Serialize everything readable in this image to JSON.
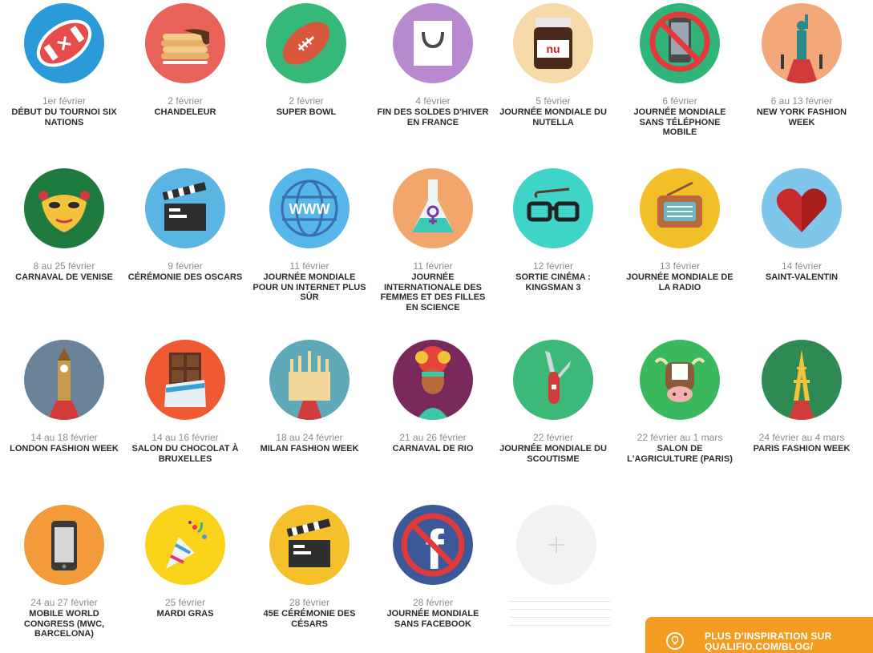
{
  "events": [
    {
      "date": "1er février",
      "title": "DÉBUT DU TOURNOI SIX NATIONS",
      "icon": "rugby-ball-icon",
      "bg": "#2a9ad8"
    },
    {
      "date": "2 février",
      "title": "CHANDELEUR",
      "icon": "crepes-icon",
      "bg": "#e8625a"
    },
    {
      "date": "2 février",
      "title": "SUPER BOWL",
      "icon": "football-icon",
      "bg": "#35b878"
    },
    {
      "date": "4 février",
      "title": "FIN DES SOLDES D'HIVER EN FRANCE",
      "icon": "shopping-bag-icon",
      "bg": "#b78acf"
    },
    {
      "date": "5 février",
      "title": "JOURNÉE MONDIALE DU NUTELLA",
      "icon": "nutella-jar-icon",
      "bg": "#f5d9a8",
      "jar_label": "nu"
    },
    {
      "date": "6 février",
      "title": "JOURNÉE MONDIALE SANS TÉLÉPHONE MOBILE",
      "icon": "no-phone-icon",
      "bg": "#2fb57a"
    },
    {
      "date": "6 au 13 février",
      "title": "NEW YORK FASHION WEEK",
      "icon": "statue-of-liberty-icon",
      "bg": "#f3a87a"
    },
    {
      "date": "8 au 25 février",
      "title": "CARNAVAL DE VENISE",
      "icon": "venice-mask-icon",
      "bg": "#1e7a3e"
    },
    {
      "date": "9 février",
      "title": "CÉRÉMONIE DES OSCARS",
      "icon": "clapperboard-icon",
      "bg": "#5bb5e3"
    },
    {
      "date": "11 février",
      "title": "JOURNÉE MONDIALE POUR UN INTERNET PLUS SÛR",
      "icon": "www-globe-icon",
      "bg": "#56b5e9",
      "www_label": "WWW"
    },
    {
      "date": "11 février",
      "title": "JOURNÉE INTERNATIONALE DES FEMMES ET DES FILLES EN SCIENCE",
      "icon": "flask-icon",
      "bg": "#f3a66b"
    },
    {
      "date": "12 février",
      "title": "SORTIE CINÉMA : KINGSMAN 3",
      "icon": "glasses-umbrella-icon",
      "bg": "#3fd4c8"
    },
    {
      "date": "13 février",
      "title": "JOURNÉE MONDIALE DE LA RADIO",
      "icon": "radio-icon",
      "bg": "#f4c02a"
    },
    {
      "date": "14 février",
      "title": "SAINT-VALENTIN",
      "icon": "heart-icon",
      "bg": "#7fc7ea"
    },
    {
      "date": "14 au 18 février",
      "title": "LONDON FASHION WEEK",
      "icon": "big-ben-icon",
      "bg": "#6b8399"
    },
    {
      "date": "14 au 16 février",
      "title": "SALON DU CHOCOLAT À BRUXELLES",
      "icon": "chocolate-bar-icon",
      "bg": "#f05a32"
    },
    {
      "date": "18 au 24 février",
      "title": "MILAN FASHION WEEK",
      "icon": "milan-cathedral-icon",
      "bg": "#5ea8b8"
    },
    {
      "date": "21 au 26 février",
      "title": "CARNAVAL DE RIO",
      "icon": "carnival-dancer-icon",
      "bg": "#7a2a5a"
    },
    {
      "date": "22 février",
      "title": "JOURNÉE MONDIALE DU SCOUTISME",
      "icon": "pocket-knife-icon",
      "bg": "#3cb878"
    },
    {
      "date": "22 février au 1 mars",
      "title": "SALON DE L'AGRICULTURE (PARIS)",
      "icon": "cow-icon",
      "bg": "#3ab85e"
    },
    {
      "date": "24 février au 4 mars",
      "title": "PARIS FASHION WEEK",
      "icon": "eiffel-tower-icon",
      "bg": "#2e8a52"
    },
    {
      "date": "24 au 27 février",
      "title": "MOBILE WORLD CONGRESS (MWC, BARCELONA)",
      "icon": "smartphone-icon",
      "bg": "#f39a3a"
    },
    {
      "date": "25 février",
      "title": "MARDI GRAS",
      "icon": "party-popper-icon",
      "bg": "#fbd21a"
    },
    {
      "date": "28 février",
      "title": "45e CÉRÉMONIE DES CÉSARS",
      "icon": "clapperboard-icon",
      "bg": "#f5c02a"
    },
    {
      "date": "28 février",
      "title": "JOURNÉE MONDIALE SANS FACEBOOK",
      "icon": "no-facebook-icon",
      "bg": "#3b5998",
      "fb_label": "f"
    }
  ],
  "add_tile": {
    "icon": "plus-icon",
    "bg": "#f2f2f2"
  },
  "cta": {
    "text": "PLUS D'INSPIRATION SUR QUALIFIO.COM/BLOG/",
    "icon": "lightbulb-icon",
    "color": "#f39c22"
  }
}
